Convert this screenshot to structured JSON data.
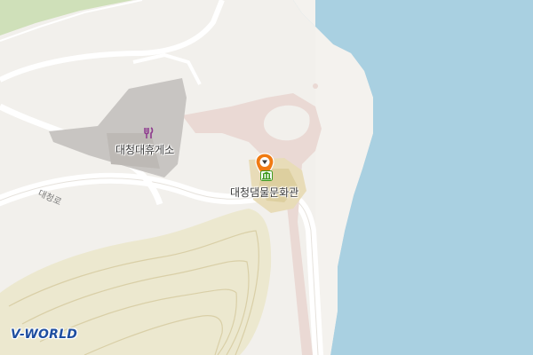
{
  "map": {
    "colors": {
      "land": "#f2f0ec",
      "water": "#a9d0e1",
      "park_green": "#cfe0b9",
      "hill_fill": "#ece8cf",
      "parking_gray": "#c8c5c2",
      "paved_pink": "#ead9d4",
      "road": "#ffffff",
      "restaurant_purple": "#8e3a8e",
      "marker_orange": "#f07a12",
      "museum_green": "#3d9a1e"
    },
    "pois": [
      {
        "name": "대청대휴게소",
        "icon": "restaurant-icon"
      },
      {
        "name": "대청댐물문화관",
        "icon": "museum-icon"
      }
    ],
    "road_labels": [
      {
        "name": "대청로"
      }
    ],
    "selected_marker": {
      "icon": "location-pin-icon"
    },
    "logo": {
      "text": "V-WORLD"
    }
  }
}
